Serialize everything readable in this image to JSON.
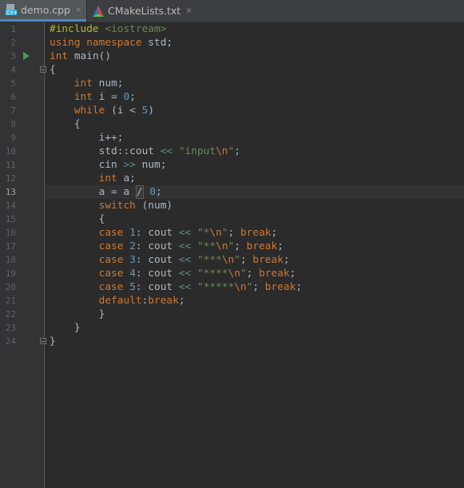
{
  "tabs": [
    {
      "label": "demo.cpp",
      "icon": "cpp-file-icon",
      "active": true
    },
    {
      "label": "CMakeLists.txt",
      "icon": "cmake-icon",
      "active": false
    }
  ],
  "close_glyph": "×",
  "current_line": 13,
  "line_numbers": [
    "1",
    "2",
    "3",
    "4",
    "5",
    "6",
    "7",
    "8",
    "9",
    "10",
    "11",
    "12",
    "13",
    "14",
    "15",
    "16",
    "17",
    "18",
    "19",
    "20",
    "21",
    "22",
    "23",
    "24"
  ],
  "code": {
    "l1": {
      "kw": "#include",
      "sp": " ",
      "inc": "<iostream>"
    },
    "l2": {
      "kw1": "using",
      "kw2": "namespace",
      "rest": " std;"
    },
    "l3": {
      "kw": "int",
      "rest": " main()"
    },
    "l4": {
      "text": "{"
    },
    "l5": {
      "indent": "    ",
      "kw": "int",
      "rest": " num;"
    },
    "l6": {
      "indent": "    ",
      "kw": "int",
      "rest": " i = ",
      "num": "0",
      "end": ";"
    },
    "l7": {
      "indent": "    ",
      "kw": "while",
      "rest": " (i < ",
      "num": "5",
      "end": ")"
    },
    "l8": {
      "indent": "    ",
      "text": "{"
    },
    "l9": {
      "indent": "        ",
      "text": "i++;"
    },
    "l10": {
      "indent": "        ",
      "pre": "std::cout ",
      "op": "<<",
      "sp": " ",
      "str": "\"input",
      "esc": "\\n",
      "strend": "\"",
      "end": ";"
    },
    "l11": {
      "indent": "        ",
      "pre": "cin ",
      "op": ">>",
      "rest": " num;"
    },
    "l12": {
      "indent": "        ",
      "kw": "int",
      "rest": " a;"
    },
    "l13": {
      "indent": "        ",
      "pre": "a = a ",
      "div": "/",
      "sp": " ",
      "num": "0",
      "end": ";"
    },
    "l14": {
      "indent": "        ",
      "kw": "switch",
      "rest": " (num)"
    },
    "l15": {
      "indent": "        ",
      "text": "{"
    },
    "l16": {
      "indent": "        ",
      "kw": "case",
      "sp": " ",
      "num": "1",
      "mid": ": cout ",
      "op": "<<",
      "sp2": " ",
      "str": "\"*",
      "esc": "\\n",
      "strend": "\"",
      "semi": "; ",
      "kw2": "break",
      "end": ";"
    },
    "l17": {
      "indent": "        ",
      "kw": "case",
      "sp": " ",
      "num": "2",
      "mid": ": cout ",
      "op": "<<",
      "sp2": " ",
      "str": "\"**",
      "esc": "\\n",
      "strend": "\"",
      "semi": "; ",
      "kw2": "break",
      "end": ";"
    },
    "l18": {
      "indent": "        ",
      "kw": "case",
      "sp": " ",
      "num": "3",
      "mid": ": cout ",
      "op": "<<",
      "sp2": " ",
      "str": "\"***",
      "esc": "\\n",
      "strend": "\"",
      "semi": "; ",
      "kw2": "break",
      "end": ";"
    },
    "l19": {
      "indent": "        ",
      "kw": "case",
      "sp": " ",
      "num": "4",
      "mid": ": cout ",
      "op": "<<",
      "sp2": " ",
      "str": "\"****",
      "esc": "\\n",
      "strend": "\"",
      "semi": "; ",
      "kw2": "break",
      "end": ";"
    },
    "l20": {
      "indent": "        ",
      "kw": "case",
      "sp": " ",
      "num": "5",
      "mid": ": cout ",
      "op": "<<",
      "sp2": " ",
      "str": "\"*****",
      "esc": "\\n",
      "strend": "\"",
      "semi": "; ",
      "kw2": "break",
      "end": ";"
    },
    "l21": {
      "indent": "        ",
      "kw": "default",
      "mid": ":",
      "kw2": "break",
      "end": ";"
    },
    "l22": {
      "indent": "        ",
      "text": "}"
    },
    "l23": {
      "indent": "    ",
      "text": "}"
    },
    "l24": {
      "text": "}"
    }
  },
  "colors": {
    "background": "#2b2b2b",
    "gutter": "#313335",
    "keyword": "#cc7832",
    "string": "#6a8759",
    "number": "#6897bb",
    "default_text": "#a9b7c6",
    "tab_active_underline": "#4a88c7",
    "run_marker": "#499c54"
  }
}
